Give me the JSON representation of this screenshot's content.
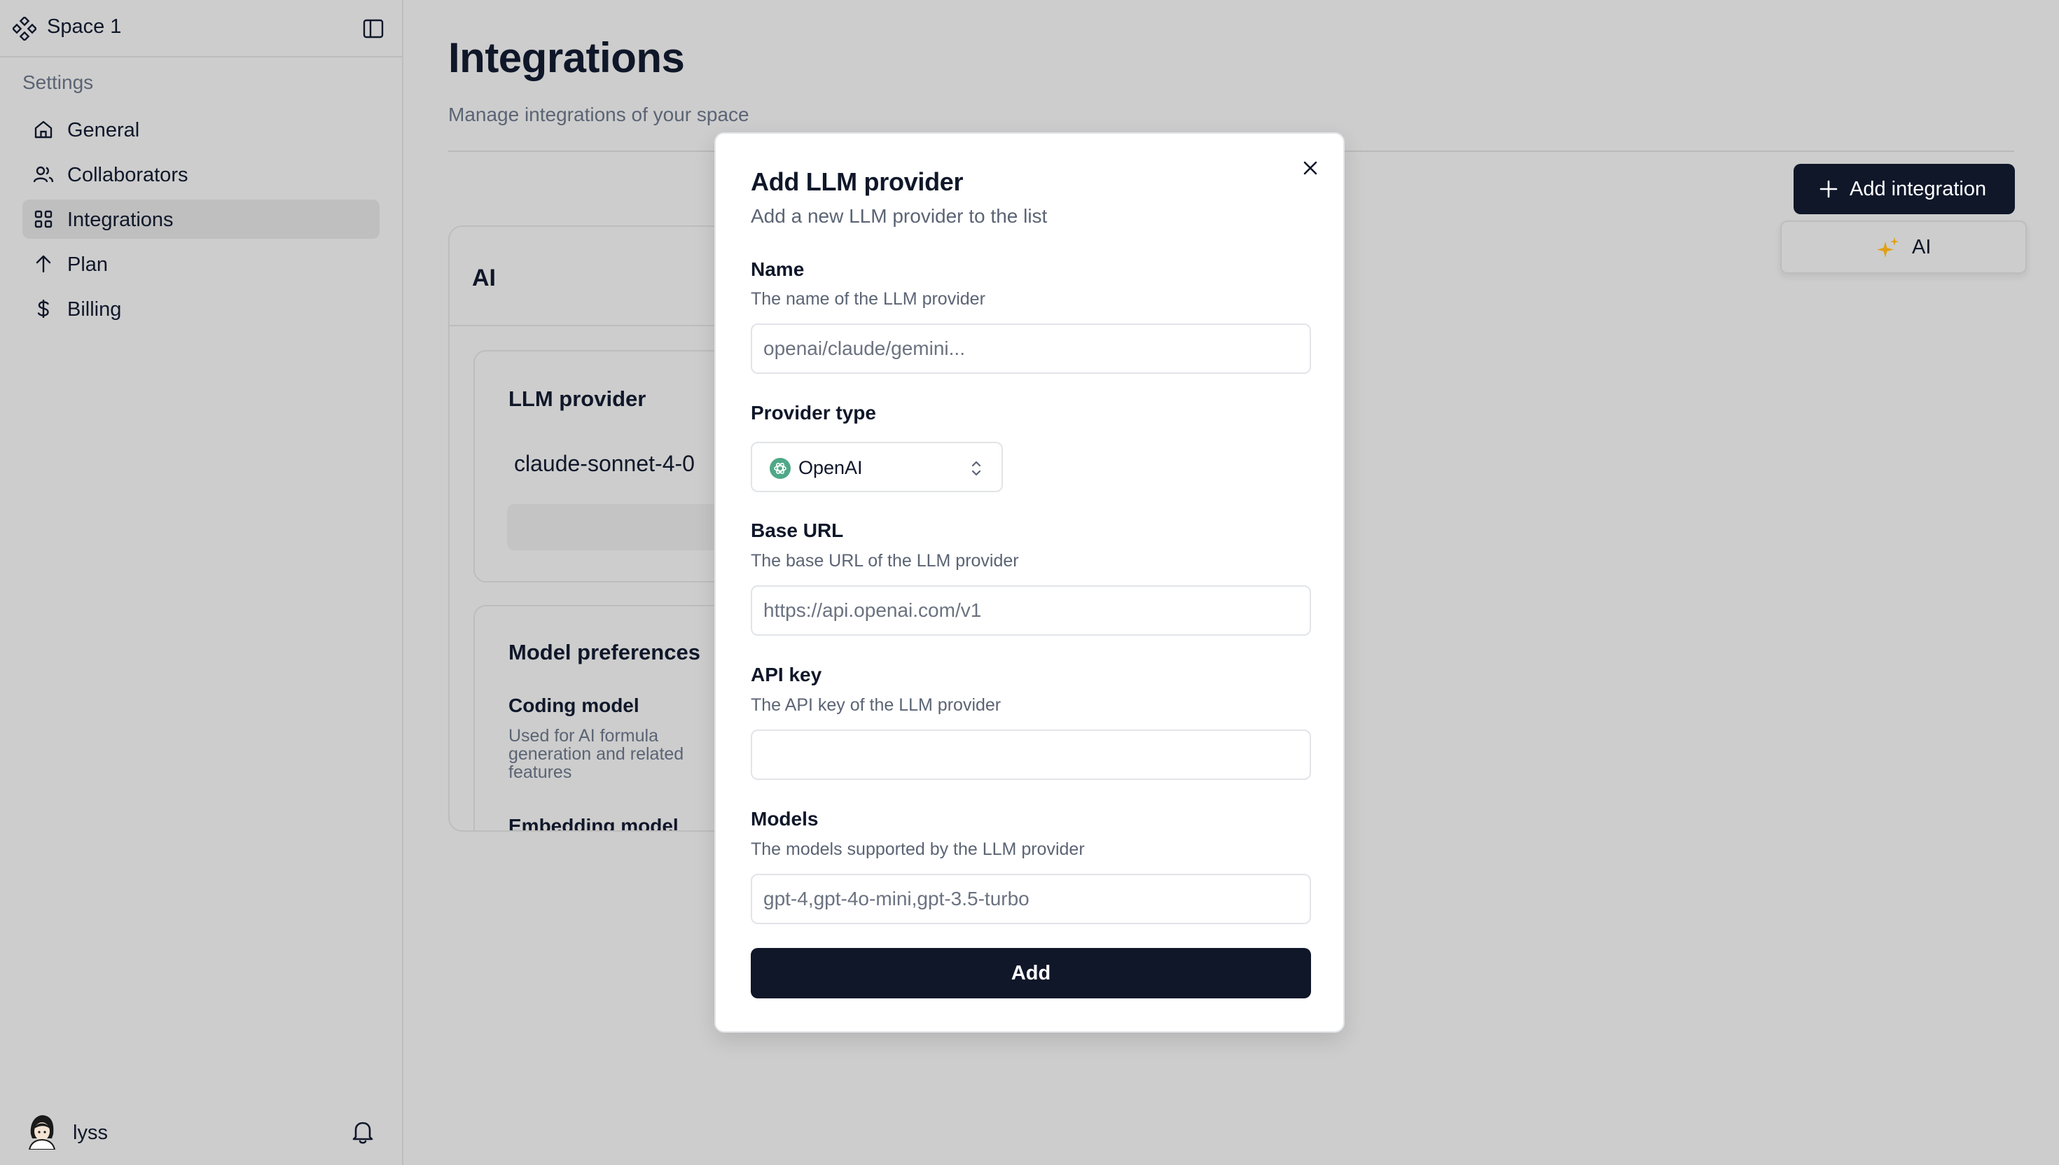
{
  "sidebar": {
    "space_name": "Space 1",
    "section_label": "Settings",
    "items": [
      {
        "label": "General",
        "icon": "home-icon"
      },
      {
        "label": "Collaborators",
        "icon": "users-icon"
      },
      {
        "label": "Integrations",
        "icon": "grid-icon",
        "active": true
      },
      {
        "label": "Plan",
        "icon": "arrow-up-icon"
      },
      {
        "label": "Billing",
        "icon": "dollar-icon"
      }
    ],
    "user": {
      "name": "lyss"
    }
  },
  "main": {
    "title": "Integrations",
    "subtitle": "Manage integrations of your space",
    "add_integration_label": "Add integration",
    "dropdown_item_label": "AI",
    "ai_card": {
      "title": "AI",
      "llm_provider": {
        "title": "LLM provider",
        "model": "claude-sonnet-4-0"
      },
      "model_preferences": {
        "title": "Model preferences",
        "coding_model_label": "Coding model",
        "coding_model_desc": "Used for AI formula generation and related features",
        "embedding_model_label": "Embedding model"
      }
    }
  },
  "modal": {
    "title": "Add LLM provider",
    "subtitle": "Add a new LLM provider to the list",
    "name": {
      "label": "Name",
      "desc": "The name of the LLM provider",
      "placeholder": "openai/claude/gemini...",
      "value": ""
    },
    "provider_type": {
      "label": "Provider type",
      "value": "OpenAI"
    },
    "base_url": {
      "label": "Base URL",
      "desc": "The base URL of the LLM provider",
      "placeholder": "https://api.openai.com/v1",
      "value": ""
    },
    "api_key": {
      "label": "API key",
      "desc": "The API key of the LLM provider",
      "placeholder": "",
      "value": ""
    },
    "models": {
      "label": "Models",
      "desc": "The models supported by the LLM provider",
      "placeholder": "gpt-4,gpt-4o-mini,gpt-3.5-turbo",
      "value": ""
    },
    "submit_label": "Add"
  },
  "colors": {
    "background": "#cdcdcd",
    "primary": "#0f1729",
    "muted_text": "#5b6474",
    "modal_bg": "#ffffff",
    "spark_accent": "#e0a015",
    "openai_logo": "#4fa888"
  }
}
